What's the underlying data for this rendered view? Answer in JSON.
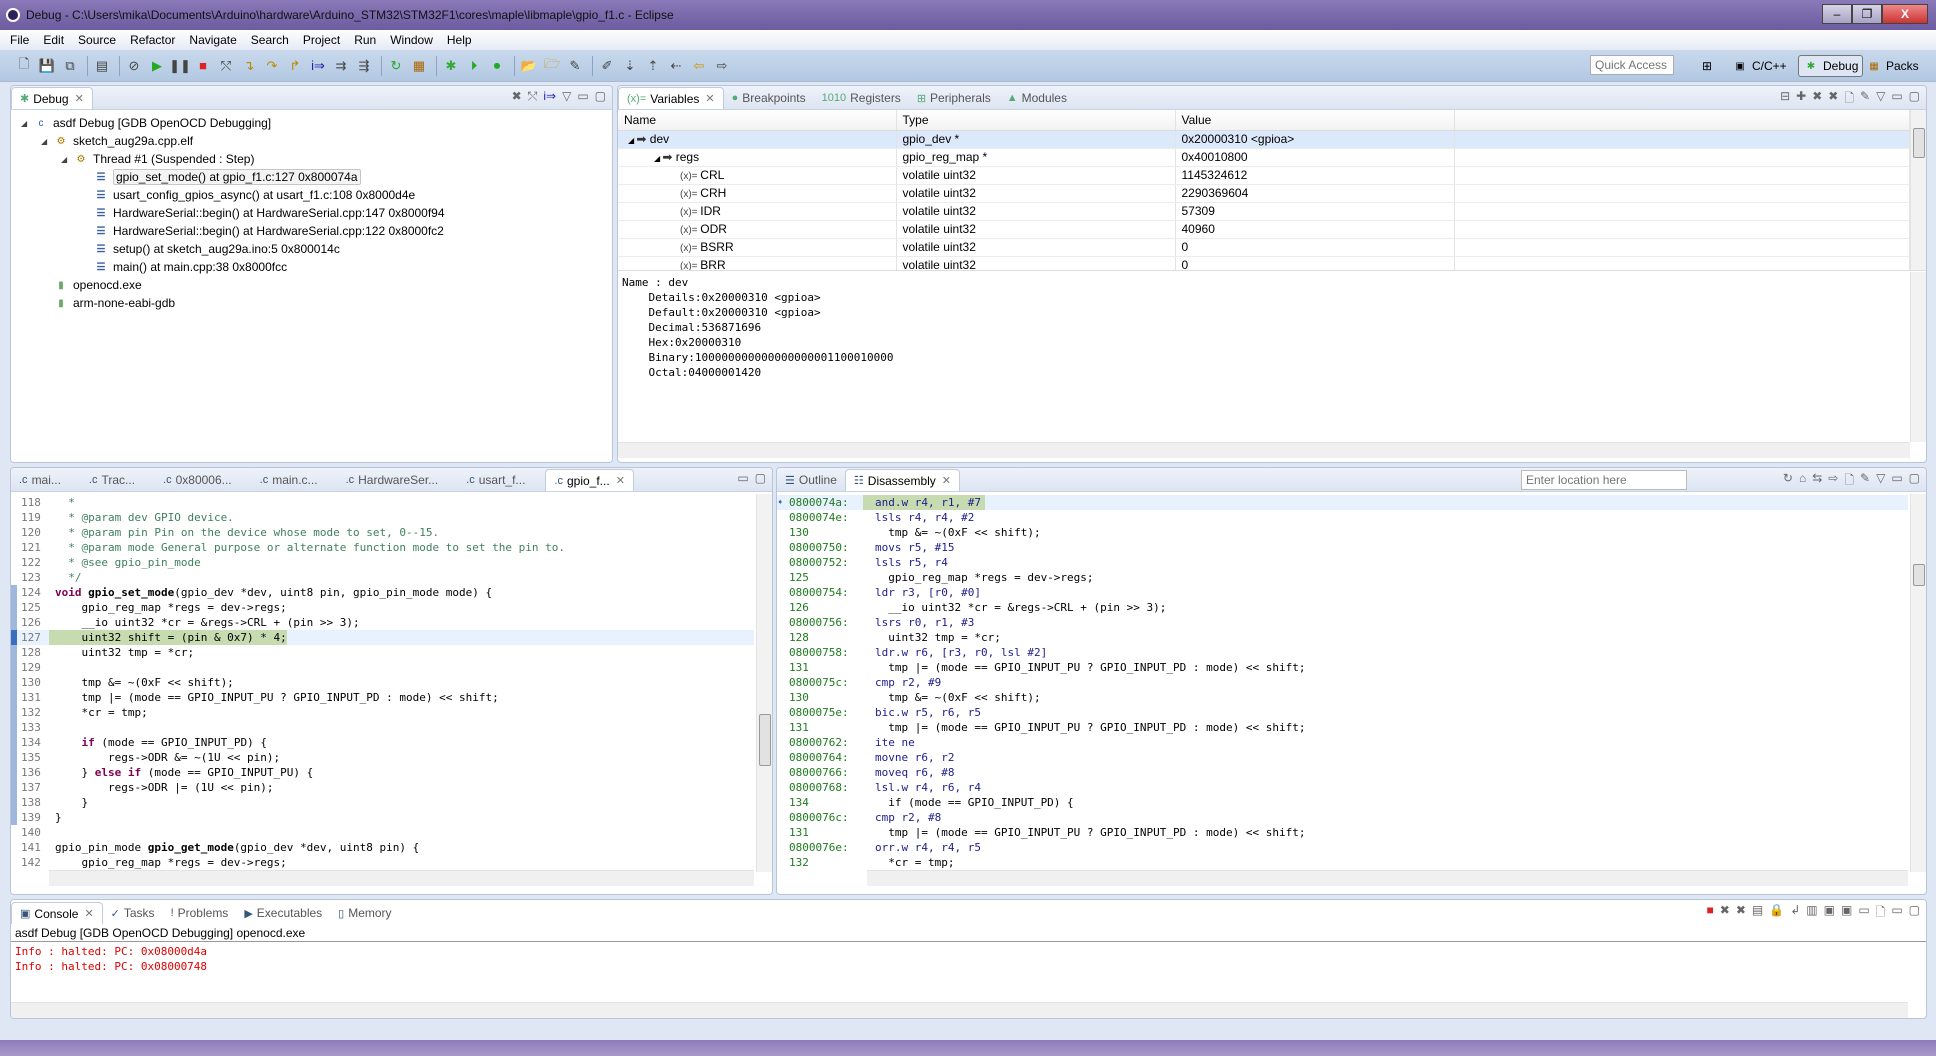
{
  "window": {
    "title": "Debug - C:\\Users\\mika\\Documents\\Arduino\\hardware\\Arduino_STM32\\STM32F1\\cores\\maple\\libmaple\\gpio_f1.c - Eclipse",
    "minimize": "–",
    "restore": "❐",
    "close": "X"
  },
  "menu": [
    "File",
    "Edit",
    "Source",
    "Refactor",
    "Navigate",
    "Search",
    "Project",
    "Run",
    "Window",
    "Help"
  ],
  "toolbar": {
    "quick_access_placeholder": "Quick Access",
    "perspectives": [
      {
        "label": "C/C++",
        "icon": "cpp-perspective-icon"
      },
      {
        "label": "Debug",
        "icon": "bug-icon",
        "active": true
      },
      {
        "label": "Packs",
        "icon": "packs-icon"
      }
    ]
  },
  "debug_view": {
    "tab": "Debug",
    "tree": [
      {
        "label": "asdf Debug [GDB OpenOCD Debugging]",
        "level": 0,
        "icon": "launch-c-icon",
        "expanded": true
      },
      {
        "label": "sketch_aug29a.cpp.elf",
        "level": 1,
        "icon": "process-icon",
        "expanded": true
      },
      {
        "label": "Thread #1 (Suspended : Step)",
        "level": 2,
        "icon": "thread-icon",
        "expanded": true
      },
      {
        "label": "gpio_set_mode() at gpio_f1.c:127 0x800074a",
        "level": 3,
        "icon": "stack-frame-icon",
        "selected": true
      },
      {
        "label": "usart_config_gpios_async() at usart_f1.c:108 0x8000d4e",
        "level": 3,
        "icon": "stack-frame-icon"
      },
      {
        "label": "HardwareSerial::begin() at HardwareSerial.cpp:147 0x8000f94",
        "level": 3,
        "icon": "stack-frame-icon"
      },
      {
        "label": "HardwareSerial::begin() at HardwareSerial.cpp:122 0x8000fc2",
        "level": 3,
        "icon": "stack-frame-icon"
      },
      {
        "label": "setup() at sketch_aug29a.ino:5 0x800014c",
        "level": 3,
        "icon": "stack-frame-icon"
      },
      {
        "label": "main() at main.cpp:38 0x8000fcc",
        "level": 3,
        "icon": "stack-frame-icon"
      },
      {
        "label": "openocd.exe",
        "level": 1,
        "icon": "exe-icon"
      },
      {
        "label": "arm-none-eabi-gdb",
        "level": 1,
        "icon": "exe-icon"
      }
    ]
  },
  "variables_view": {
    "tabs": [
      "Variables",
      "Breakpoints",
      "Registers",
      "Peripherals",
      "Modules"
    ],
    "columns": [
      "Name",
      "Type",
      "Value"
    ],
    "rows": [
      {
        "name": "dev",
        "type": "gpio_dev *",
        "value": "0x20000310 <gpioa>",
        "level": 0,
        "kind": "pointer",
        "selected": true
      },
      {
        "name": "regs",
        "type": "gpio_reg_map *",
        "value": "0x40010800",
        "level": 1,
        "kind": "pointer"
      },
      {
        "name": "CRL",
        "type": "volatile uint32",
        "value": "1145324612",
        "level": 2,
        "kind": "var"
      },
      {
        "name": "CRH",
        "type": "volatile uint32",
        "value": "2290369604",
        "level": 2,
        "kind": "var"
      },
      {
        "name": "IDR",
        "type": "volatile uint32",
        "value": "57309",
        "level": 2,
        "kind": "var"
      },
      {
        "name": "ODR",
        "type": "volatile uint32",
        "value": "40960",
        "level": 2,
        "kind": "var"
      },
      {
        "name": "BSRR",
        "type": "volatile uint32",
        "value": "0",
        "level": 2,
        "kind": "var"
      },
      {
        "name": "BRR",
        "type": "volatile uint32",
        "value": "0",
        "level": 2,
        "kind": "var"
      }
    ],
    "details": [
      "Name : dev",
      "    Details:0x20000310 <gpioa>",
      "    Default:0x20000310 <gpioa>",
      "    Decimal:536871696",
      "    Hex:0x20000310",
      "    Binary:100000000000000000001100010000",
      "    Octal:04000001420"
    ]
  },
  "editor": {
    "tabs": [
      "mai...",
      "Trac...",
      "0x80006...",
      "main.c...",
      "HardwareSer...",
      "usart_f...",
      "gpio_f..."
    ],
    "active_tab": 6,
    "current_line": 127,
    "lines": [
      {
        "n": 118,
        "s": [
          [
            "  *",
            "cm"
          ]
        ]
      },
      {
        "n": 119,
        "s": [
          [
            "  * @param dev GPIO device.",
            "cm"
          ]
        ]
      },
      {
        "n": 120,
        "s": [
          [
            "  * @param pin Pin on the device whose mode to set, 0--15.",
            "cm"
          ]
        ]
      },
      {
        "n": 121,
        "s": [
          [
            "  * @param mode General purpose or alternate function mode to set the pin to.",
            "cm"
          ]
        ]
      },
      {
        "n": 122,
        "s": [
          [
            "  * @see gpio_pin_mode",
            "cm"
          ]
        ]
      },
      {
        "n": 123,
        "s": [
          [
            "  */",
            "cm"
          ]
        ]
      },
      {
        "n": 124,
        "s": [
          [
            "void",
            "kw"
          ],
          [
            " ",
            ""
          ],
          [
            "gpio_set_mode",
            "fn"
          ],
          [
            "(gpio_dev *dev, uint8 pin, gpio_pin_mode mode) {",
            ""
          ]
        ]
      },
      {
        "n": 125,
        "s": [
          [
            "    gpio_reg_map *regs = dev->regs;",
            ""
          ]
        ]
      },
      {
        "n": 126,
        "s": [
          [
            "    __io uint32 *cr = &regs->CRL + (pin >> 3);",
            ""
          ]
        ]
      },
      {
        "n": 127,
        "s": [
          [
            "    uint32 shift = (pin & 0x7) * 4;",
            ""
          ]
        ]
      },
      {
        "n": 128,
        "s": [
          [
            "    uint32 tmp = *cr;",
            ""
          ]
        ]
      },
      {
        "n": 129,
        "s": [
          [
            "",
            ""
          ]
        ]
      },
      {
        "n": 130,
        "s": [
          [
            "    tmp &= ~(0xF << shift);",
            ""
          ]
        ]
      },
      {
        "n": 131,
        "s": [
          [
            "    tmp |= (mode == GPIO_INPUT_PU ? GPIO_INPUT_PD : mode) << shift;",
            ""
          ]
        ]
      },
      {
        "n": 132,
        "s": [
          [
            "    *cr = tmp;",
            ""
          ]
        ]
      },
      {
        "n": 133,
        "s": [
          [
            "",
            ""
          ]
        ]
      },
      {
        "n": 134,
        "s": [
          [
            "    ",
            ""
          ],
          [
            "if",
            "kw"
          ],
          [
            " (mode == GPIO_INPUT_PD) {",
            ""
          ]
        ]
      },
      {
        "n": 135,
        "s": [
          [
            "        regs->ODR &= ~(1U << pin);",
            ""
          ]
        ]
      },
      {
        "n": 136,
        "s": [
          [
            "    } ",
            ""
          ],
          [
            "else if",
            "kw"
          ],
          [
            " (mode == GPIO_INPUT_PU) {",
            ""
          ]
        ]
      },
      {
        "n": 137,
        "s": [
          [
            "        regs->ODR |= (1U << pin);",
            ""
          ]
        ]
      },
      {
        "n": 138,
        "s": [
          [
            "    }",
            ""
          ]
        ]
      },
      {
        "n": 139,
        "s": [
          [
            "}",
            ""
          ]
        ]
      },
      {
        "n": 140,
        "s": [
          [
            "",
            ""
          ]
        ]
      },
      {
        "n": 141,
        "s": [
          [
            "gpio_pin_mode ",
            ""
          ],
          [
            "gpio_get_mode",
            "fn"
          ],
          [
            "(gpio_dev *dev, uint8 pin) {",
            ""
          ]
        ]
      },
      {
        "n": 142,
        "s": [
          [
            "    gpio_reg_map *regs = dev->regs;",
            ""
          ]
        ]
      }
    ]
  },
  "disassembly": {
    "tabs": [
      "Outline",
      "Disassembly"
    ],
    "location_placeholder": "Enter location here",
    "lines": [
      {
        "a": "0800074a:",
        "t": "and.w r4, r1, #7",
        "cur": true
      },
      {
        "a": "0800074e:",
        "t": "lsls r4, r4, #2"
      },
      {
        "a": "130",
        "t": "  tmp &= ~(0xF << shift);",
        "src": true
      },
      {
        "a": "08000750:",
        "t": "movs r5, #15"
      },
      {
        "a": "08000752:",
        "t": "lsls r5, r4"
      },
      {
        "a": "125",
        "t": "  gpio_reg_map *regs = dev->regs;",
        "src": true
      },
      {
        "a": "08000754:",
        "t": "ldr r3, [r0, #0]"
      },
      {
        "a": "126",
        "t": "  __io uint32 *cr = &regs->CRL + (pin >> 3);",
        "src": true
      },
      {
        "a": "08000756:",
        "t": "lsrs r0, r1, #3"
      },
      {
        "a": "128",
        "t": "  uint32 tmp = *cr;",
        "src": true
      },
      {
        "a": "08000758:",
        "t": "ldr.w r6, [r3, r0, lsl #2]"
      },
      {
        "a": "131",
        "t": "  tmp |= (mode == GPIO_INPUT_PU ? GPIO_INPUT_PD : mode) << shift;",
        "src": true
      },
      {
        "a": "0800075c:",
        "t": "cmp r2, #9"
      },
      {
        "a": "130",
        "t": "  tmp &= ~(0xF << shift);",
        "src": true
      },
      {
        "a": "0800075e:",
        "t": "bic.w r5, r6, r5"
      },
      {
        "a": "131",
        "t": "  tmp |= (mode == GPIO_INPUT_PU ? GPIO_INPUT_PD : mode) << shift;",
        "src": true
      },
      {
        "a": "08000762:",
        "t": "ite ne"
      },
      {
        "a": "08000764:",
        "t": "movne r6, r2"
      },
      {
        "a": "08000766:",
        "t": "moveq r6, #8"
      },
      {
        "a": "08000768:",
        "t": "lsl.w r4, r6, r4"
      },
      {
        "a": "134",
        "t": "  if (mode == GPIO_INPUT_PD) {",
        "src": true
      },
      {
        "a": "0800076c:",
        "t": "cmp r2, #8"
      },
      {
        "a": "131",
        "t": "  tmp |= (mode == GPIO_INPUT_PU ? GPIO_INPUT_PD : mode) << shift;",
        "src": true
      },
      {
        "a": "0800076e:",
        "t": "orr.w r4, r4, r5"
      },
      {
        "a": "132",
        "t": "  *cr = tmp;",
        "src": true
      }
    ]
  },
  "console": {
    "tabs": [
      "Console",
      "Tasks",
      "Problems",
      "Executables",
      "Memory"
    ],
    "header": "asdf Debug [GDB OpenOCD Debugging] openocd.exe",
    "lines": [
      "Info : halted: PC: 0x08000d4a",
      "Info : halted: PC: 0x08000748"
    ],
    "error_color": "#e00000"
  },
  "colors": {
    "comment": "#3f7f5f",
    "keyword": "#7f0055",
    "address": "#1f7a1f",
    "instruction": "#1d1d8a",
    "current_line": "#c7dbb0"
  }
}
